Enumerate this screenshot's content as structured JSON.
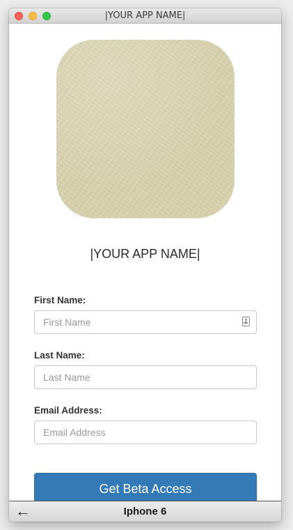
{
  "window": {
    "title": "|YOUR APP NAME|"
  },
  "app": {
    "name": "|YOUR APP NAME|",
    "icon_color": "#d7d2ae"
  },
  "form": {
    "first_name": {
      "label": "First Name:",
      "placeholder": "First Name",
      "value": "",
      "icon": "contact-card-icon"
    },
    "last_name": {
      "label": "Last Name:",
      "placeholder": "Last Name",
      "value": ""
    },
    "email": {
      "label": "Email Address:",
      "placeholder": "Email Address",
      "value": ""
    },
    "submit_label": "Get Beta Access",
    "submit_color": "#337ab7"
  },
  "bottom_bar": {
    "back_icon": "←",
    "device_name": "Iphone 6"
  }
}
